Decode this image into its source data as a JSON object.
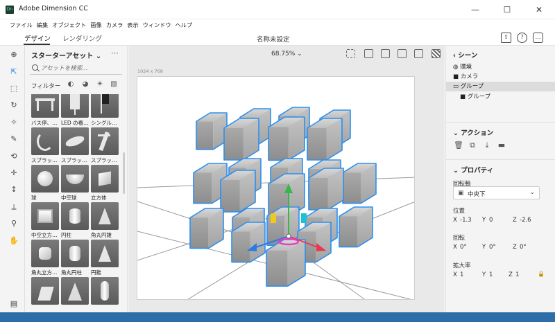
{
  "window": {
    "title": "Adobe Dimension CC",
    "logo_text": "Dn",
    "minimize": "—",
    "maximize": "☐",
    "close": "✕"
  },
  "menu": [
    "ファイル",
    "編集",
    "オブジェクト",
    "画像",
    "カメラ",
    "表示",
    "ウィンドウ",
    "ヘルプ"
  ],
  "modes": {
    "design": "デザイン",
    "render": "レンダリング"
  },
  "document_title": "名称未設定",
  "top_icons": {
    "share": "⇪",
    "help": "?",
    "feedback": "…"
  },
  "assets": {
    "header": "スターターアセット ⌄",
    "more": "⋯",
    "search_placeholder": "アセットを検索…",
    "filter_label": "フィルター",
    "items": [
      {
        "label": "バス停、…",
        "icon": "bus-stop-shelter"
      },
      {
        "label": "LED の看…",
        "icon": "led-sign"
      },
      {
        "label": "シングル…",
        "icon": "single-sign"
      },
      {
        "label": "スプラッ…",
        "icon": "splash-crescent"
      },
      {
        "label": "スプラッ…",
        "icon": "splash-burst"
      },
      {
        "label": "スプラッ…",
        "icon": "splash-spray"
      },
      {
        "label": "球",
        "icon": "sphere"
      },
      {
        "label": "中空球",
        "icon": "hollow-sphere"
      },
      {
        "label": "立方体",
        "icon": "cube"
      },
      {
        "label": "中空立方…",
        "icon": "hollow-cube"
      },
      {
        "label": "円柱",
        "icon": "cylinder"
      },
      {
        "label": "角丸円錐",
        "icon": "rounded-cone"
      },
      {
        "label": "角丸立方…",
        "icon": "rounded-cube"
      },
      {
        "label": "角丸円柱",
        "icon": "rounded-cylinder"
      },
      {
        "label": "円錐",
        "icon": "cone"
      },
      {
        "label": "",
        "icon": "wedge"
      },
      {
        "label": "",
        "icon": "prism"
      },
      {
        "label": "",
        "icon": "capsule"
      }
    ]
  },
  "viewport": {
    "zoom": "68.75% ⌄",
    "canvas_size": "1024 x 768"
  },
  "scene": {
    "header": "シーン",
    "items": [
      {
        "label": "環境",
        "icon": "environment-icon"
      },
      {
        "label": "カメラ",
        "icon": "camera-icon"
      },
      {
        "label": "グループ",
        "icon": "folder-icon",
        "selected": true
      },
      {
        "label": "グループ",
        "icon": "folder-icon",
        "child": true
      }
    ]
  },
  "actions": {
    "header": "アクション"
  },
  "properties": {
    "header": "プロパティ",
    "pivot_label": "回転軸",
    "pivot_value": "中央下",
    "position_label": "位置",
    "position": {
      "x": "-1.3",
      "y": "0",
      "z": "-2.6"
    },
    "rotation_label": "回転",
    "rotation": {
      "x": "0°",
      "y": "0°",
      "z": "0°"
    },
    "scale_label": "拡大率",
    "scale": {
      "x": "1",
      "y": "1",
      "z": "1"
    }
  },
  "colors": {
    "accent": "#1d7ae0",
    "selection_outline": "#2a8ff0",
    "gizmo_green": "#39b54a",
    "gizmo_red": "#e8384f",
    "gizmo_blue": "#2a7be4",
    "gizmo_yellow": "#f2c81e"
  }
}
